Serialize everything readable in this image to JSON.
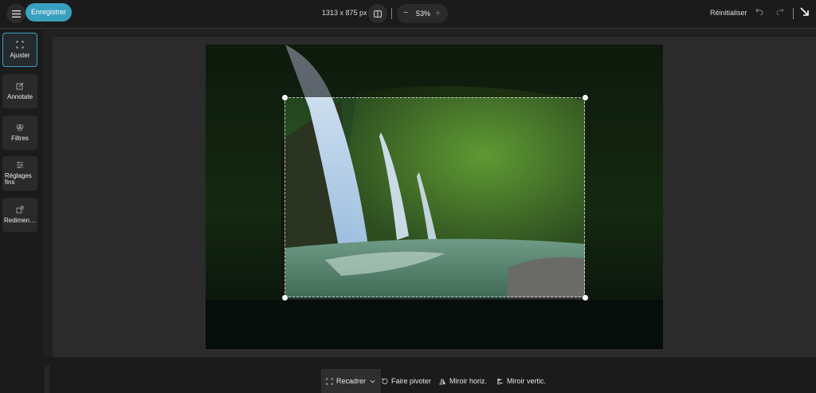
{
  "topbar": {
    "save_label": "Enregistrer",
    "image_dimensions": "1313 x 875 px",
    "zoom_level": "53%",
    "zoom_minus": "−",
    "zoom_plus": "+",
    "reset_label": "Réinitialiser"
  },
  "sidebar": {
    "items": [
      {
        "label": "Ajuster",
        "icon": "crop-frame-icon",
        "active": true
      },
      {
        "label": "Annotate",
        "icon": "edit-pencil-icon",
        "active": false
      },
      {
        "label": "Filtres",
        "icon": "filters-circles-icon",
        "active": false
      },
      {
        "label": "Réglages fins",
        "icon": "sliders-icon",
        "active": false
      },
      {
        "label": "Redimen…",
        "icon": "resize-icon",
        "active": false
      }
    ]
  },
  "bottom_tools": {
    "crop_label": "Recadrer",
    "rotate_label": "Faire pivoter",
    "flip_h_label": "Miroir horiz.",
    "flip_v_label": "Miroir vertic."
  },
  "colors": {
    "accent": "#3aa0c0",
    "background": "#202020",
    "panel": "#1b1b1b"
  }
}
